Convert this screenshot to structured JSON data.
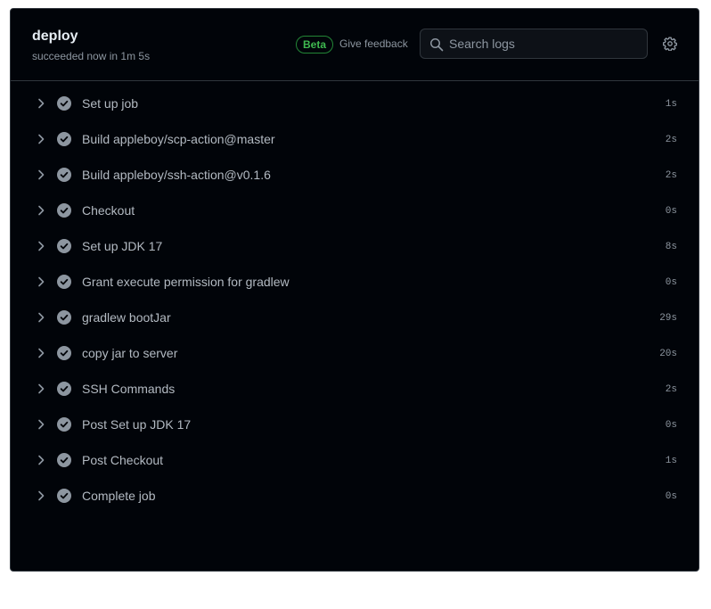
{
  "job": {
    "title": "deploy",
    "status": "succeeded now in 1m 5s"
  },
  "header": {
    "beta_badge": "Beta",
    "feedback_link": "Give feedback",
    "search_placeholder": "Search logs",
    "search_value": ""
  },
  "icons": {
    "search": "search-icon",
    "settings": "gear-icon",
    "expand": "chevron-right-icon",
    "status": "check-circle-icon"
  },
  "colors": {
    "panel_bg": "#010409",
    "border": "#30363d",
    "success_badge": "#3fb950",
    "step_icon": "#8d96a0"
  },
  "steps": [
    {
      "name": "Set up job",
      "duration": "1s"
    },
    {
      "name": "Build appleboy/scp-action@master",
      "duration": "2s"
    },
    {
      "name": "Build appleboy/ssh-action@v0.1.6",
      "duration": "2s"
    },
    {
      "name": "Checkout",
      "duration": "0s"
    },
    {
      "name": "Set up JDK 17",
      "duration": "8s"
    },
    {
      "name": "Grant execute permission for gradlew",
      "duration": "0s"
    },
    {
      "name": "gradlew bootJar",
      "duration": "29s"
    },
    {
      "name": "copy jar to server",
      "duration": "20s"
    },
    {
      "name": "SSH Commands",
      "duration": "2s"
    },
    {
      "name": "Post Set up JDK 17",
      "duration": "0s"
    },
    {
      "name": "Post Checkout",
      "duration": "1s"
    },
    {
      "name": "Complete job",
      "duration": "0s"
    }
  ]
}
